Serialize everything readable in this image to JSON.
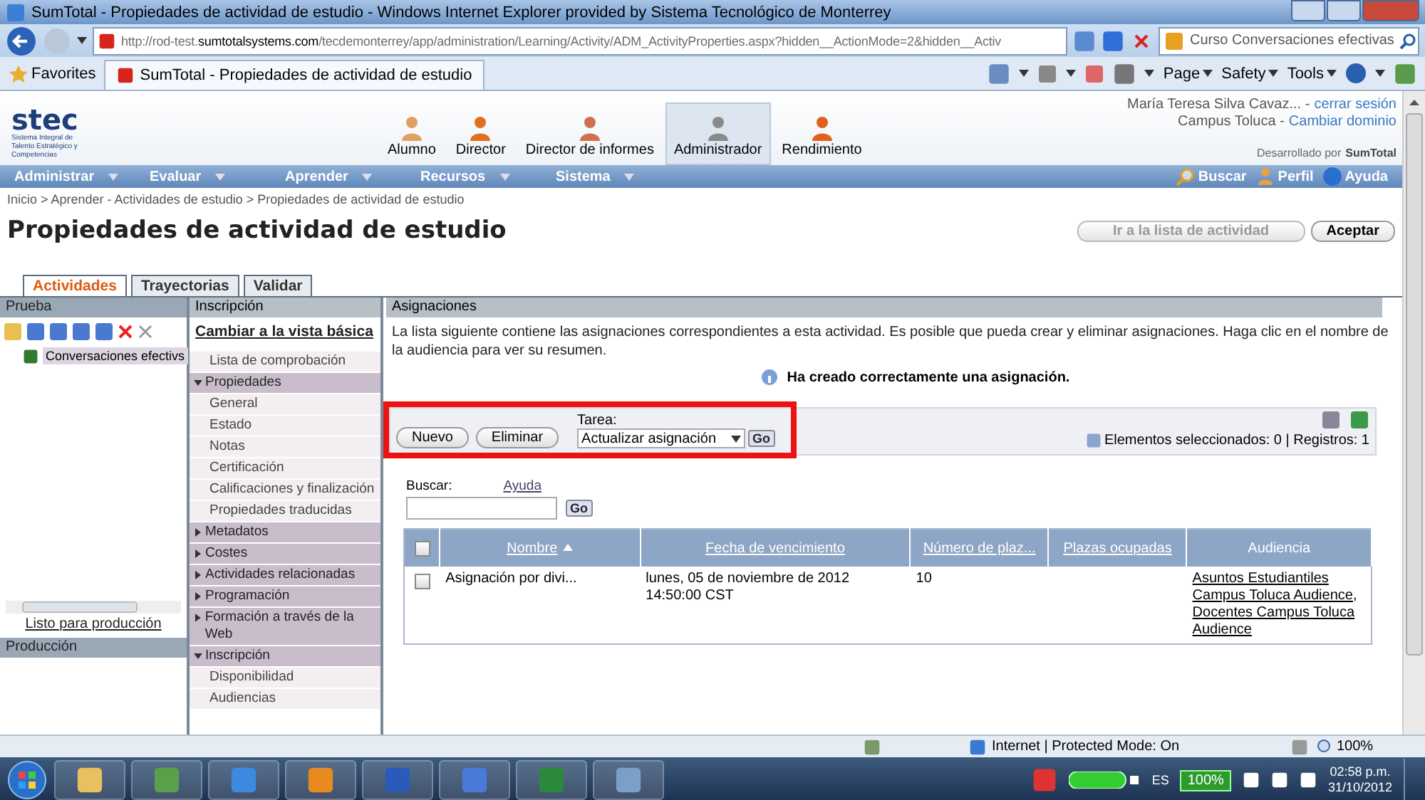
{
  "window": {
    "title": "SumTotal - Propiedades de actividad de estudio - Windows Internet Explorer provided by Sistema Tecnológico de Monterrey"
  },
  "address_bar": {
    "url": "http://rod-test.**sumtotalsystems.com**/tecdemonterrey/app/administration/Learning/Activity/ADM_ActivityProperties.aspx?hidden__ActionMode=2&hidden__Activ"
  },
  "search_box": {
    "value": "Curso Conversaciones efectivas"
  },
  "favorites": {
    "label": "Favorites",
    "tab_title": "SumTotal - Propiedades de actividad de estudio"
  },
  "command_bar": [
    "Page",
    "Safety",
    "Tools"
  ],
  "logo": {
    "name": "stec",
    "subtitle": "Sistema Integral de Talento Estratégico y Competencias"
  },
  "roles": [
    {
      "label": "Alumno",
      "selected": false
    },
    {
      "label": "Director",
      "selected": false
    },
    {
      "label": "Director de informes",
      "selected": false
    },
    {
      "label": "Administrador",
      "selected": true
    },
    {
      "label": "Rendimiento",
      "selected": false
    }
  ],
  "user": {
    "name": "María Teresa Silva Cavaz... -",
    "logout": "cerrar sesión",
    "domain": "Campus Toluca -",
    "change_domain": "Cambiar dominio",
    "powered_by": "Desarrollado por",
    "brand": "SumTotal"
  },
  "menu": [
    "Administrar",
    "Evaluar",
    "Aprender",
    "Recursos",
    "Sistema"
  ],
  "menu_right": [
    "Buscar",
    "Perfil",
    "Ayuda"
  ],
  "breadcrumb": "Inicio > Aprender - Actividades de estudio > Propiedades de actividad de estudio",
  "page_title": "Propiedades de actividad de estudio",
  "header_buttons": [
    {
      "label": "Ir a la lista de actividad",
      "disabled": true
    },
    {
      "label": "Aceptar",
      "disabled": false
    }
  ],
  "tabs": [
    {
      "label": "Actividades",
      "selected": true
    },
    {
      "label": "Trayectorias",
      "selected": false
    },
    {
      "label": "Validar",
      "selected": false
    }
  ],
  "test_panel": {
    "title": "Prueba",
    "tree_item": "Conversaciones efectivs",
    "footer_link": "Listo para producción"
  },
  "production_panel": {
    "title": "Producción"
  },
  "nav": {
    "title": "Inscripción",
    "basic_view": "Cambiar a la vista básica",
    "items": [
      {
        "label": "Lista de comprobación",
        "kind": "link"
      },
      {
        "label": "Propiedades",
        "kind": "section",
        "expanded": true
      },
      {
        "label": "General",
        "kind": "link"
      },
      {
        "label": "Estado",
        "kind": "link"
      },
      {
        "label": "Notas",
        "kind": "link"
      },
      {
        "label": "Certificación",
        "kind": "link"
      },
      {
        "label": "Calificaciones y finalización",
        "kind": "link"
      },
      {
        "label": "Propiedades traducidas",
        "kind": "link"
      },
      {
        "label": "Metadatos",
        "kind": "section",
        "expanded": false
      },
      {
        "label": "Costes",
        "kind": "section",
        "expanded": false
      },
      {
        "label": "Actividades relacionadas",
        "kind": "section",
        "expanded": false
      },
      {
        "label": "Programación",
        "kind": "section",
        "expanded": false
      },
      {
        "label": "Formación a través de la Web",
        "kind": "section",
        "expanded": false
      },
      {
        "label": "Inscripción",
        "kind": "section",
        "expanded": true
      },
      {
        "label": "Disponibilidad",
        "kind": "link"
      },
      {
        "label": "Audiencias",
        "kind": "link"
      }
    ]
  },
  "content": {
    "title": "Asignaciones",
    "description": "La lista siguiente contiene las asignaciones correspondientes a esta actividad. Es posible que pueda crear y eliminar asignaciones. Haga clic en el nombre de la audiencia para ver su resumen.",
    "message": "Ha creado correctamente una asignación.",
    "toolbar": {
      "buttons": [
        "Nuevo",
        "Eliminar"
      ],
      "task_label": "Tarea:",
      "task_value": "Actualizar asignación",
      "go": "Go",
      "status": "Elementos seleccionados: 0 | Registros: 1"
    },
    "search": {
      "label": "Buscar:",
      "help": "Ayuda",
      "go": "Go"
    },
    "table": {
      "columns": [
        {
          "label": "Nombre",
          "sorted": true,
          "link": true
        },
        {
          "label": "Fecha de vencimiento",
          "sorted": false,
          "link": true
        },
        {
          "label": "Número de plaz...",
          "sorted": false,
          "link": true
        },
        {
          "label": "Plazas ocupadas",
          "sorted": false,
          "link": true
        },
        {
          "label": "Audiencia",
          "sorted": false,
          "link": false
        }
      ],
      "select_all_checked": false,
      "rows": [
        {
          "checked": false,
          "separator": ",",
          "name": "Asignación por divi...",
          "due": "lunes, 05 de noviembre de 2012 14:50:00 CST",
          "places": "10",
          "audiences": [
            "Asuntos Estudiantiles Campus Toluca Audience",
            "Docentes Campus Toluca Audience"
          ]
        }
      ]
    }
  },
  "status_bar": {
    "zone": "Internet | Protected Mode: On",
    "zoom": "100%"
  },
  "taskbar": {
    "language": "ES",
    "battery": "100%",
    "time": "02:58 p.m.",
    "date": "31/10/2012"
  }
}
